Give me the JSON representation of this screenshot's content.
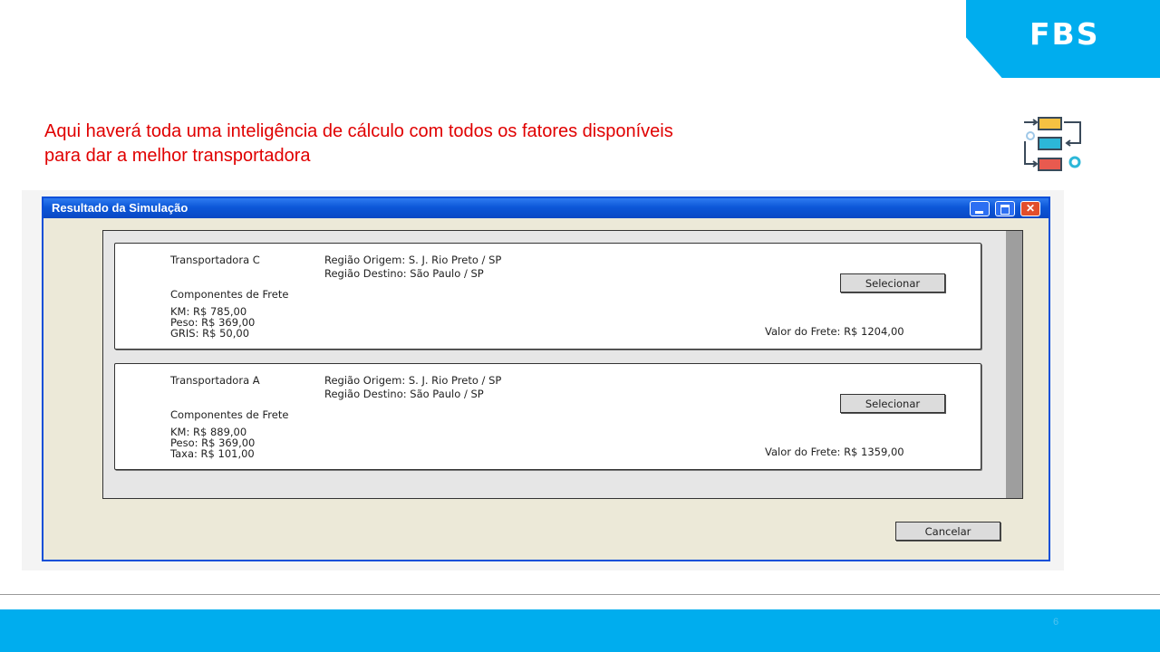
{
  "brand": {
    "logo_text": "FBS",
    "accent_color": "#00adee"
  },
  "caption": {
    "line1": "Aqui haverá toda uma inteligência de cálculo com todos os fatores disponíveis",
    "line2": "para dar a melhor transportadora"
  },
  "icons": {
    "flow": "process-flow-icon"
  },
  "window": {
    "title": "Resultado da Simulação",
    "controls": [
      "minimize-icon",
      "maximize-icon",
      "close-icon"
    ]
  },
  "results": [
    {
      "carrier": "Transportadora C",
      "origin": "Região Origem: S. J. Rio Preto / SP",
      "destination": "Região Destino: São Paulo / SP",
      "components_title": "Componentes de Frete",
      "components": [
        "KM: R$ 785,00",
        "Peso: R$ 369,00",
        "GRIS: R$ 50,00"
      ],
      "total": "Valor do Frete: R$ 1204,00",
      "select_label": "Selecionar"
    },
    {
      "carrier": "Transportadora A",
      "origin": "Região Origem: S. J. Rio Preto / SP",
      "destination": "Região Destino: São Paulo / SP",
      "components_title": "Componentes de Frete",
      "components": [
        "KM: R$ 889,00",
        "Peso: R$ 369,00",
        "Taxa: R$ 101,00"
      ],
      "total": "Valor do Frete: R$ 1359,00",
      "select_label": "Selecionar"
    }
  ],
  "cancel_label": "Cancelar",
  "page_number": "6"
}
